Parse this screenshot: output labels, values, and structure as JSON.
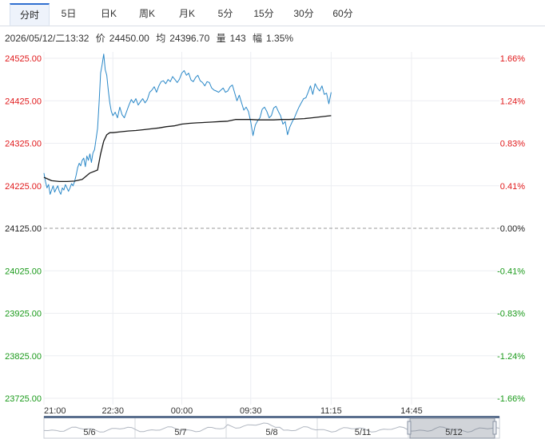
{
  "tabs": [
    {
      "label": "分时",
      "active": true
    },
    {
      "label": "5日",
      "active": false
    },
    {
      "label": "日K",
      "active": false
    },
    {
      "label": "周K",
      "active": false
    },
    {
      "label": "月K",
      "active": false
    },
    {
      "label": "5分",
      "active": false
    },
    {
      "label": "15分",
      "active": false
    },
    {
      "label": "30分",
      "active": false
    },
    {
      "label": "60分",
      "active": false
    }
  ],
  "info": {
    "datetime": "2026/05/12/二13:32",
    "price_label": "价",
    "price": "24450.00",
    "avg_label": "均",
    "avg": "24396.70",
    "vol_label": "量",
    "vol": "143",
    "chg_label": "幅",
    "chg": "1.35%"
  },
  "colors": {
    "up": "#e0191b",
    "down": "#1a9a1a",
    "flat": "#222222",
    "price_line": "#2a88c8",
    "avg_line": "#1a1a1a"
  },
  "chart_data": {
    "type": "line",
    "ylim": [
      23725,
      24525
    ],
    "base": 24125,
    "price_ticks": [
      "24525.00",
      "24425.00",
      "24325.00",
      "24225.00",
      "24125.00",
      "24025.00",
      "23925.00",
      "23825.00",
      "23725.00"
    ],
    "pct_ticks": [
      "1.66%",
      "1.24%",
      "0.83%",
      "0.41%",
      "0.00%",
      "-0.41%",
      "-0.83%",
      "-1.24%",
      "-1.66%"
    ],
    "x_ticks": [
      "21:00",
      "22:30",
      "00:00",
      "09:30",
      "11:15",
      "14:45"
    ],
    "x_tick_pos": [
      0,
      90,
      180,
      270,
      375,
      480
    ],
    "x_max": 480,
    "series": [
      {
        "key": "price",
        "x": [
          0,
          2,
          4,
          6,
          8,
          10,
          12,
          14,
          16,
          18,
          20,
          22,
          24,
          26,
          28,
          30,
          32,
          34,
          36,
          38,
          40,
          42,
          44,
          46,
          48,
          50,
          52,
          54,
          56,
          58,
          60,
          62,
          64,
          66,
          68,
          70,
          72,
          74,
          76,
          78,
          80,
          82,
          84,
          86,
          88,
          90,
          93,
          96,
          99,
          102,
          105,
          108,
          111,
          114,
          117,
          120,
          123,
          126,
          129,
          132,
          135,
          138,
          141,
          144,
          147,
          150,
          153,
          156,
          159,
          162,
          165,
          168,
          171,
          174,
          177,
          180,
          183,
          186,
          189,
          192,
          195,
          198,
          201,
          204,
          207,
          210,
          213,
          216,
          219,
          222,
          225,
          228,
          231,
          234,
          237,
          240,
          243,
          246,
          249,
          252,
          255,
          258,
          261,
          264,
          267,
          270,
          273,
          276,
          279,
          282,
          285,
          288,
          291,
          294,
          297,
          300,
          303,
          306,
          309,
          312,
          315,
          318,
          321,
          324,
          327,
          330,
          333,
          336,
          339,
          342,
          345,
          348,
          351,
          354,
          357,
          360,
          363,
          366,
          369,
          372,
          375
        ],
        "values": [
          24255,
          24235,
          24220,
          24228,
          24205,
          24215,
          24225,
          24210,
          24218,
          24225,
          24212,
          24205,
          24220,
          24215,
          24228,
          24220,
          24212,
          24220,
          24230,
          24225,
          24235,
          24250,
          24268,
          24278,
          24272,
          24285,
          24290,
          24270,
          24295,
          24285,
          24300,
          24280,
          24302,
          24310,
          24335,
          24360,
          24420,
          24490,
          24510,
          24535,
          24498,
          24485,
          24450,
          24420,
          24400,
          24390,
          24398,
          24385,
          24410,
          24392,
          24385,
          24400,
          24415,
          24428,
          24420,
          24430,
          24415,
          24423,
          24430,
          24420,
          24428,
          24445,
          24450,
          24458,
          24445,
          24460,
          24470,
          24472,
          24465,
          24475,
          24470,
          24482,
          24475,
          24468,
          24476,
          24490,
          24496,
          24485,
          24490,
          24474,
          24470,
          24480,
          24485,
          24472,
          24468,
          24460,
          24470,
          24468,
          24455,
          24450,
          24448,
          24445,
          24450,
          24455,
          24445,
          24448,
          24458,
          24462,
          24444,
          24425,
          24438,
          24420,
          24403,
          24410,
          24400,
          24375,
          24343,
          24368,
          24378,
          24385,
          24405,
          24410,
          24400,
          24385,
          24390,
          24408,
          24412,
          24400,
          24390,
          24370,
          24376,
          24345,
          24363,
          24375,
          24385,
          24398,
          24410,
          24420,
          24430,
          24432,
          24445,
          24460,
          24440,
          24465,
          24455,
          24448,
          24460,
          24440,
          24443,
          24418,
          24445
        ]
      },
      {
        "key": "avg",
        "x": [
          0,
          10,
          20,
          30,
          40,
          50,
          60,
          70,
          74,
          78,
          82,
          86,
          90,
          100,
          110,
          120,
          130,
          140,
          150,
          160,
          170,
          180,
          190,
          200,
          210,
          220,
          230,
          240,
          245,
          250,
          260,
          270,
          280,
          290,
          300,
          310,
          320,
          330,
          340,
          350,
          360,
          370,
          375
        ],
        "values": [
          24245,
          24237,
          24235,
          24235,
          24236,
          24240,
          24255,
          24262,
          24300,
          24330,
          24345,
          24350,
          24350,
          24352,
          24354,
          24355,
          24357,
          24359,
          24361,
          24364,
          24366,
          24370,
          24372,
          24373,
          24374,
          24375,
          24376,
          24377,
          24379,
          24381,
          24381,
          24381,
          24380,
          24380,
          24380,
          24381,
          24381,
          24382,
          24383,
          24385,
          24387,
          24389,
          24390
        ]
      }
    ]
  },
  "navigator": {
    "labels": [
      "5/6",
      "5/7",
      "5/8",
      "5/11",
      "5/12"
    ]
  }
}
